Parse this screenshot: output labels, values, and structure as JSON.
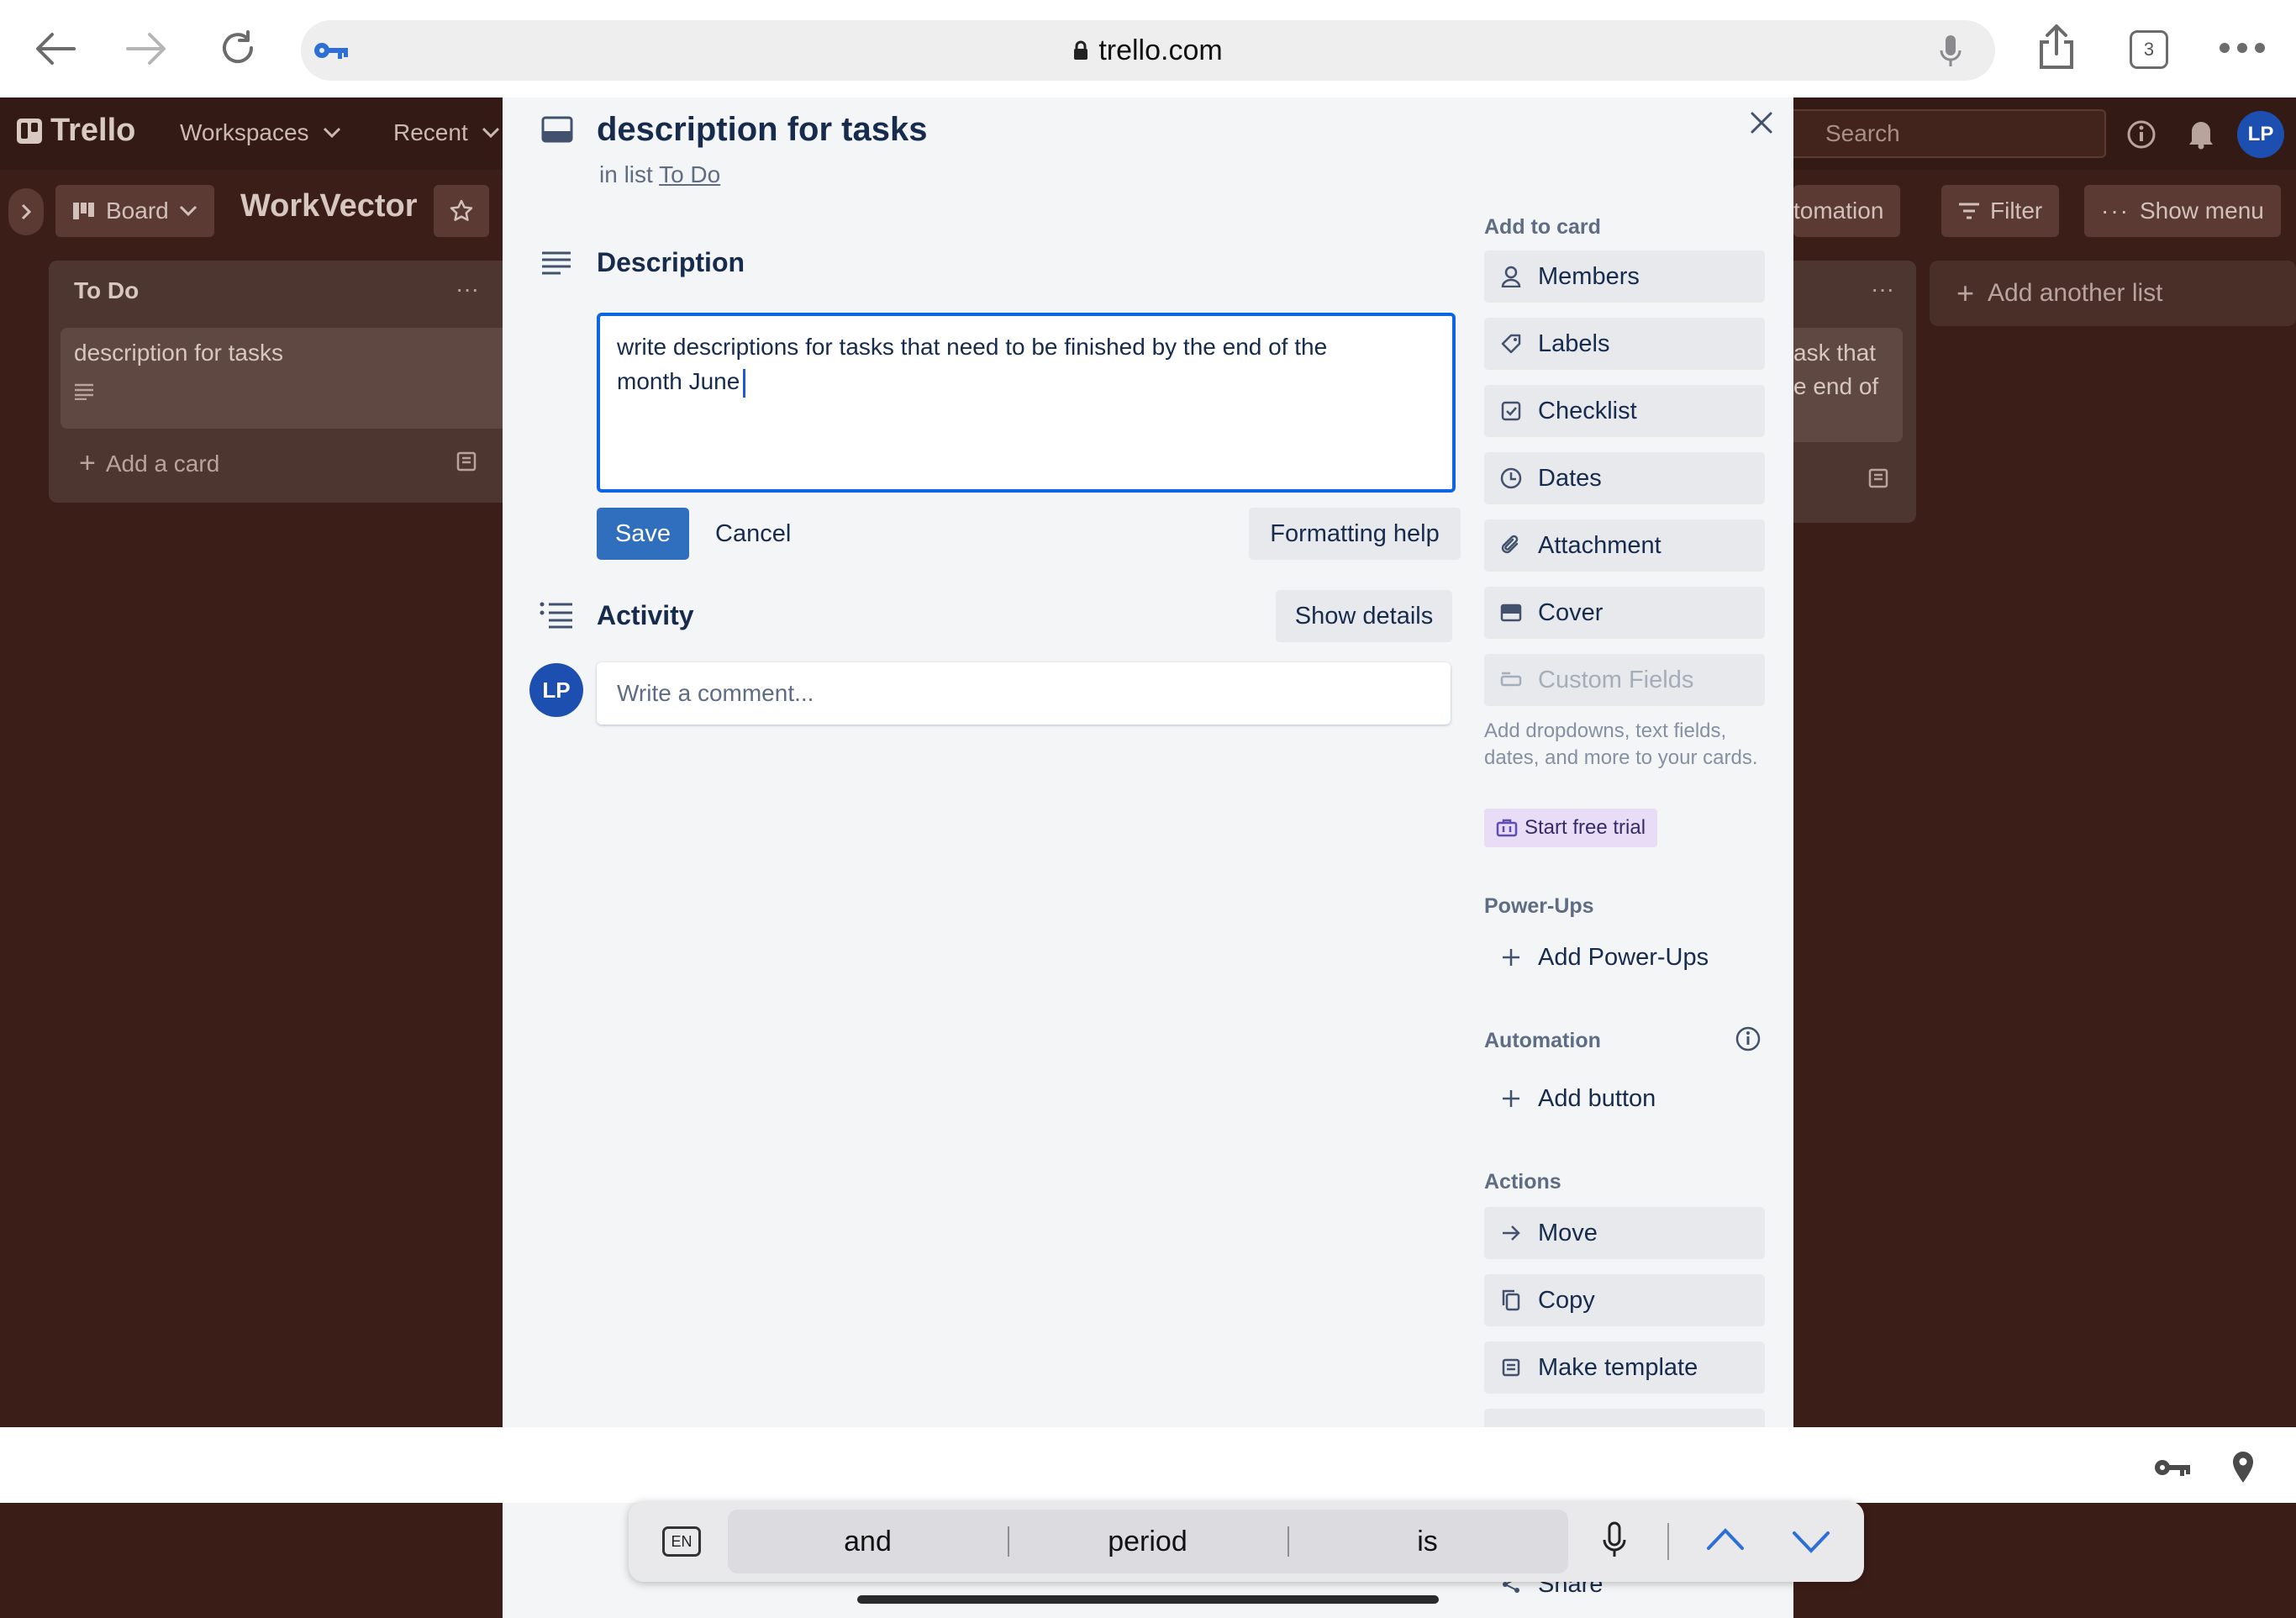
{
  "browser": {
    "url": "trello.com",
    "tab_count": "3"
  },
  "trello": {
    "logo": "Trello",
    "menu": [
      "Workspaces",
      "Recent"
    ],
    "search_placeholder": "Search",
    "avatar": "LP",
    "board_view": "Board",
    "board_name": "WorkVector",
    "automation": "tomation",
    "filter": "Filter",
    "show_menu": "Show menu",
    "lists": [
      {
        "title": "To Do",
        "cards": [
          "description for tasks"
        ],
        "add_card": "Add a card"
      },
      {
        "card_text_lines": [
          "ask that",
          "e end of"
        ]
      }
    ],
    "add_another_list": "Add another list"
  },
  "card_modal": {
    "title": "description for tasks",
    "in_list_prefix": "in list",
    "list_name": "To Do",
    "description_label": "Description",
    "description_line1": "write descriptions for tasks that need to be finished by the end of the",
    "description_line2": "month June",
    "save": "Save",
    "cancel": "Cancel",
    "formatting_help": "Formatting help",
    "activity_label": "Activity",
    "show_details": "Show details",
    "comment_avatar": "LP",
    "comment_placeholder": "Write a comment...",
    "sidebar": {
      "add_to_card": "Add to card",
      "members": "Members",
      "labels": "Labels",
      "checklist": "Checklist",
      "dates": "Dates",
      "attachment": "Attachment",
      "cover": "Cover",
      "custom_fields": "Custom Fields",
      "custom_fields_note": "Add dropdowns, text fields, dates, and more to your cards.",
      "start_free_trial": "Start free trial",
      "power_ups": "Power-Ups",
      "add_power_ups": "Add Power-Ups",
      "automation": "Automation",
      "add_button": "Add button",
      "actions": "Actions",
      "move": "Move",
      "copy": "Copy",
      "make_template": "Make template",
      "share": "Share"
    }
  },
  "keyboard": {
    "language": "EN",
    "predictions": [
      "and",
      "period",
      "is"
    ]
  },
  "colors": {
    "accent": "#0c66e4",
    "save_button": "#2f6fbd",
    "board_bg": "#3c1e18",
    "avatar": "#1d4fb0"
  }
}
